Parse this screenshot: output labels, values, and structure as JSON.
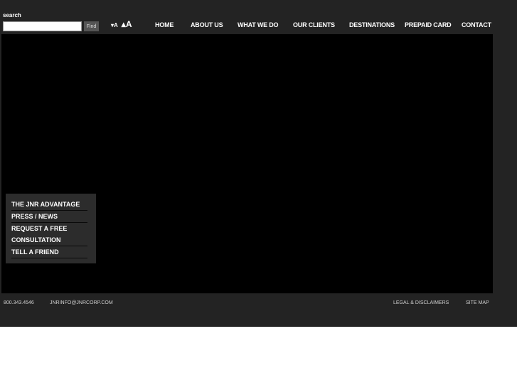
{
  "search": {
    "label": "search",
    "value": "",
    "placeholder": "",
    "button_label": "Find"
  },
  "font_controls": {
    "decrease_label": "▾A",
    "increase_label": "▴A"
  },
  "nav": {
    "items": [
      {
        "label": "HOME"
      },
      {
        "label": "ABOUT US"
      },
      {
        "label": "WHAT WE DO"
      },
      {
        "label": "OUR CLIENTS"
      },
      {
        "label": "DESTINATIONS"
      },
      {
        "label": "PREPAID CARD"
      },
      {
        "label": "CONTACT"
      }
    ]
  },
  "side_menu": {
    "items": [
      {
        "label": "THE JNR ADVANTAGE"
      },
      {
        "label": "PRESS / NEWS"
      },
      {
        "label": "REQUEST A FREE CONSULTATION"
      },
      {
        "label": "TELL A FRIEND"
      }
    ]
  },
  "footer": {
    "phone": "800.343.4546",
    "email": "JNRINFO@JNRCORP.COM",
    "legal": "LEGAL & DISCLAIMERS",
    "sitemap": "SITE MAP"
  },
  "colors": {
    "frame": "#232323",
    "hero": "#000000",
    "side_menu": "#2c2c2c",
    "text": "#ffffff"
  }
}
